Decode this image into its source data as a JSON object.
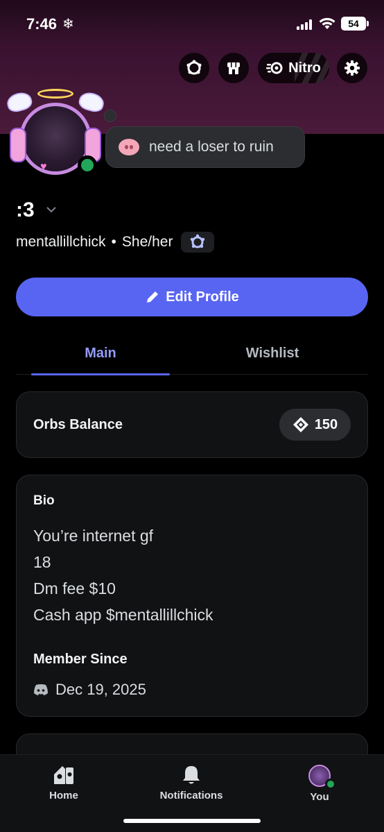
{
  "status_bar": {
    "time": "7:46",
    "time_icon": "snowflake-icon",
    "battery": "54"
  },
  "header": {
    "nitro_label": "Nitro",
    "buttons": [
      "nitro-badge-icon",
      "shop-icon",
      "nitro-icon",
      "gear-icon"
    ]
  },
  "profile": {
    "status": "need a loser to ruin",
    "status_emoji": "pig-nose-icon",
    "display_name": ":3",
    "username": "mentallillchick",
    "separator": "•",
    "pronouns": "She/her",
    "online": true
  },
  "edit_button": {
    "label": "Edit Profile"
  },
  "tabs": [
    {
      "label": "Main",
      "active": true
    },
    {
      "label": "Wishlist",
      "active": false
    }
  ],
  "orbs": {
    "label": "Orbs Balance",
    "value": "150"
  },
  "bio": {
    "heading": "Bio",
    "lines": [
      "You’re internet gf",
      "18",
      "Dm fee $10",
      "Cash app $mentallillchick"
    ]
  },
  "member_since": {
    "heading": "Member Since",
    "date": "Dec 19, 2025"
  },
  "bottom_nav": [
    {
      "label": "Home",
      "icon": "home-icon"
    },
    {
      "label": "Notifications",
      "icon": "bell-icon"
    },
    {
      "label": "You",
      "icon": "avatar"
    }
  ],
  "colors": {
    "accent": "#5865f2",
    "online": "#23a55a",
    "tab_active": "#949cf7",
    "banner": "#4a1a3a"
  }
}
